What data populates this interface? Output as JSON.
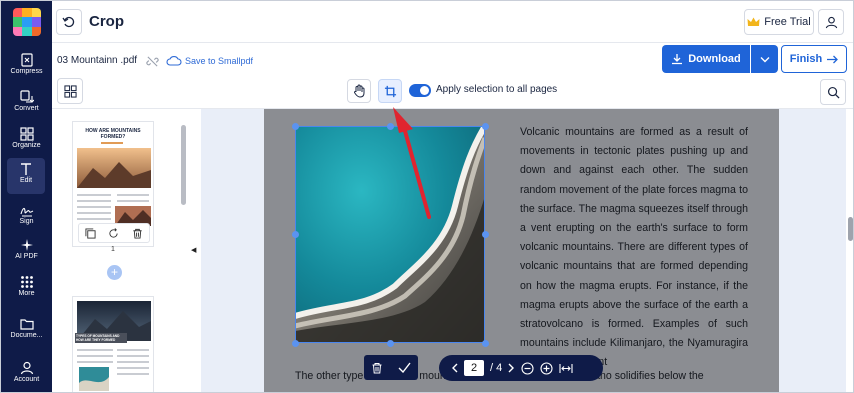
{
  "app": {
    "logo_colors": [
      "#ff5a5a",
      "#ffb020",
      "#ffd84a",
      "#3cc36b",
      "#2a9df4",
      "#7a5cf0",
      "#ff7ab6",
      "#34d1c4",
      "#f06a2a"
    ]
  },
  "rail": {
    "items": [
      {
        "label": "Compress",
        "icon": "compress-icon"
      },
      {
        "label": "Convert",
        "icon": "convert-icon"
      },
      {
        "label": "Organize",
        "icon": "organize-icon"
      },
      {
        "label": "Edit",
        "icon": "edit-icon",
        "active": true
      },
      {
        "label": "Sign",
        "icon": "sign-icon"
      },
      {
        "label": "AI PDF",
        "icon": "sparkle-icon"
      },
      {
        "label": "More",
        "icon": "more-grid-icon"
      },
      {
        "label": "Docume...",
        "icon": "folder-icon"
      },
      {
        "label": "Account",
        "icon": "account-icon"
      }
    ]
  },
  "header": {
    "title": "Crop",
    "free_trial": "Free Trial"
  },
  "toolbar": {
    "filename": "03 Mountainn .pdf",
    "save_link": "Save to Smallpdf",
    "apply_label": "Apply selection to all pages",
    "apply_on": true,
    "download": "Download",
    "finish": "Finish"
  },
  "thumbnails": {
    "page1_title": "HOW ARE MOUNTAINS FORMED?",
    "page1_number": "1",
    "page2_title": "TYPES OF MOUNTAINS AND HOW ARE THEY FORMED"
  },
  "document": {
    "paragraph": "Volcanic mountains are formed as a result of movements in tectonic plates pushing up and down and against each other. The sudden random movement of the plate forces magma to the surface. The magma squeezes itself through a vent erupting on the earth's surface to form volcanic mountains. There are different types of volcanic mountains that are formed depending on how the magma erupts. For instance, if the magma erupts above the surface of the earth a stratovolcano is formed. Examples of such mountains include Kilimanjaro, the Nyamuragira in DRC and Mount",
    "bottom_line": "The other type of volcanic mountain is formed when lava or volcano solidifies below the"
  },
  "pager": {
    "current": "2",
    "total": "/ 4"
  },
  "colors": {
    "primary": "#1f64d8",
    "rail": "#0f1b48",
    "annotation_arrow": "#e0242f"
  }
}
